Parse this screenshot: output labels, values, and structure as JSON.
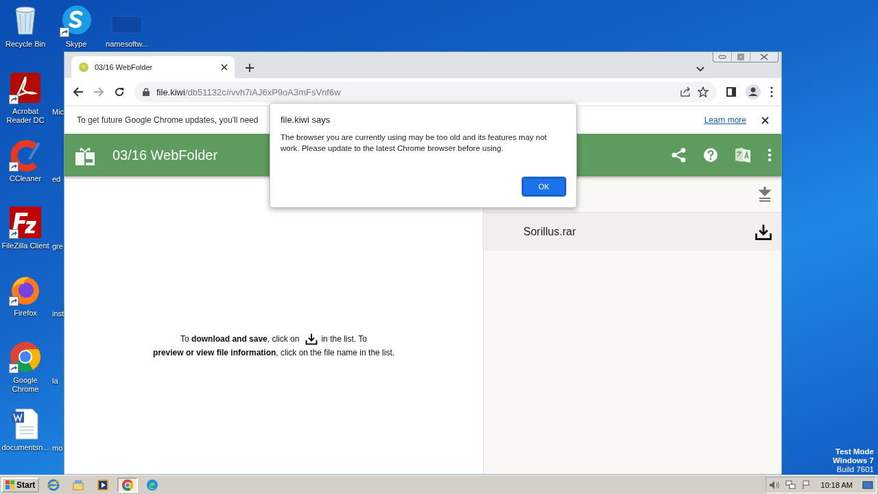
{
  "desktop": {
    "icons": [
      {
        "label": "Recycle Bin",
        "kind": "recycle",
        "shortcut": false
      },
      {
        "label": "Skype",
        "kind": "skype",
        "shortcut": true
      },
      {
        "label": "namesoftw...",
        "kind": "blank",
        "shortcut": false
      },
      {
        "label": "Acrobat Reader DC",
        "kind": "acrobat",
        "shortcut": true
      },
      {
        "label": "CCleaner",
        "kind": "ccleaner",
        "shortcut": true
      },
      {
        "label": "FileZilla Client",
        "kind": "filezilla",
        "shortcut": true
      },
      {
        "label": "Firefox",
        "kind": "firefox",
        "shortcut": true
      },
      {
        "label": "Google Chrome",
        "kind": "chrome",
        "shortcut": true
      },
      {
        "label": "documentsn...",
        "kind": "word",
        "shortcut": false
      }
    ],
    "hidden_labels": [
      "Mic",
      "ed",
      "gre",
      "inst",
      "la",
      "mo"
    ],
    "test_mode": [
      "Test Mode",
      "Windows 7",
      "Build 7601"
    ]
  },
  "browser": {
    "tab": {
      "title": "03/16 WebFolder"
    },
    "address": {
      "host": "file.kiwi",
      "path": "/db51132c#vvh7iAJ6xP9oA3mFsVnf6w"
    },
    "infobar": {
      "text": "To get future Google Chrome updates, you'll need",
      "link": "Learn more"
    },
    "app": {
      "title": "03/16 WebFolder",
      "hint_before": "To **download and save**, click on",
      "hint_after": "in the list. To",
      "hint_second_line": "**preview or view file information**, click on the file name in the list.",
      "files": [
        {
          "name": "Sorillus.rar"
        }
      ]
    }
  },
  "dialog": {
    "title": "file.kiwi says",
    "message": "The browser you are currently using may be too old and its features may not work. Please update to the latest Chrome browser before using.",
    "button": "OK"
  },
  "taskbar": {
    "start": "Start",
    "apps": [
      {
        "kind": "ie",
        "selected": false
      },
      {
        "kind": "explorer",
        "selected": false
      },
      {
        "kind": "media",
        "selected": false
      },
      {
        "kind": "chrome",
        "selected": true
      },
      {
        "kind": "edge",
        "selected": false
      }
    ],
    "clock": "10:18 AM"
  }
}
